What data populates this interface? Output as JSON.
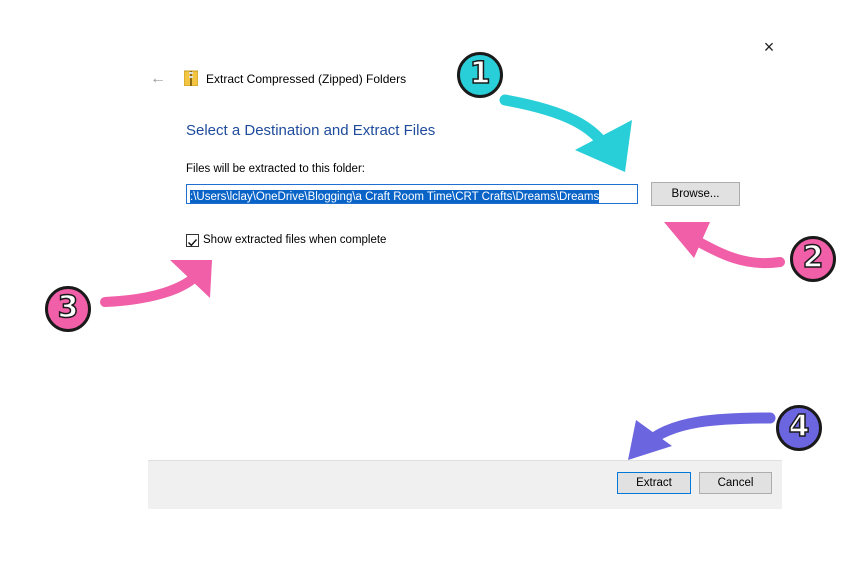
{
  "window": {
    "title": "Extract Compressed (Zipped) Folders",
    "close_symbol": "×",
    "back_symbol": "←"
  },
  "main": {
    "heading": "Select a Destination and Extract Files",
    "path_label": "Files will be extracted to this folder:",
    "path_value": ":\\Users\\lclay\\OneDrive\\Blogging\\a Craft Room Time\\CRT Crafts\\Dreams\\Dreams",
    "browse_label": "Browse...",
    "show_files_label": "Show extracted files when complete",
    "show_files_checked": true
  },
  "footer": {
    "extract_label": "Extract",
    "cancel_label": "Cancel"
  },
  "annotations": {
    "badge1": "1",
    "badge2": "2",
    "badge3": "3",
    "badge4": "4",
    "colors": {
      "cyan": "#29cfd8",
      "pink": "#f05fa8",
      "purple": "#6b66e0"
    }
  },
  "icons": [
    "close-icon",
    "back-arrow-icon",
    "zip-folder-icon",
    "checkmark-icon"
  ]
}
